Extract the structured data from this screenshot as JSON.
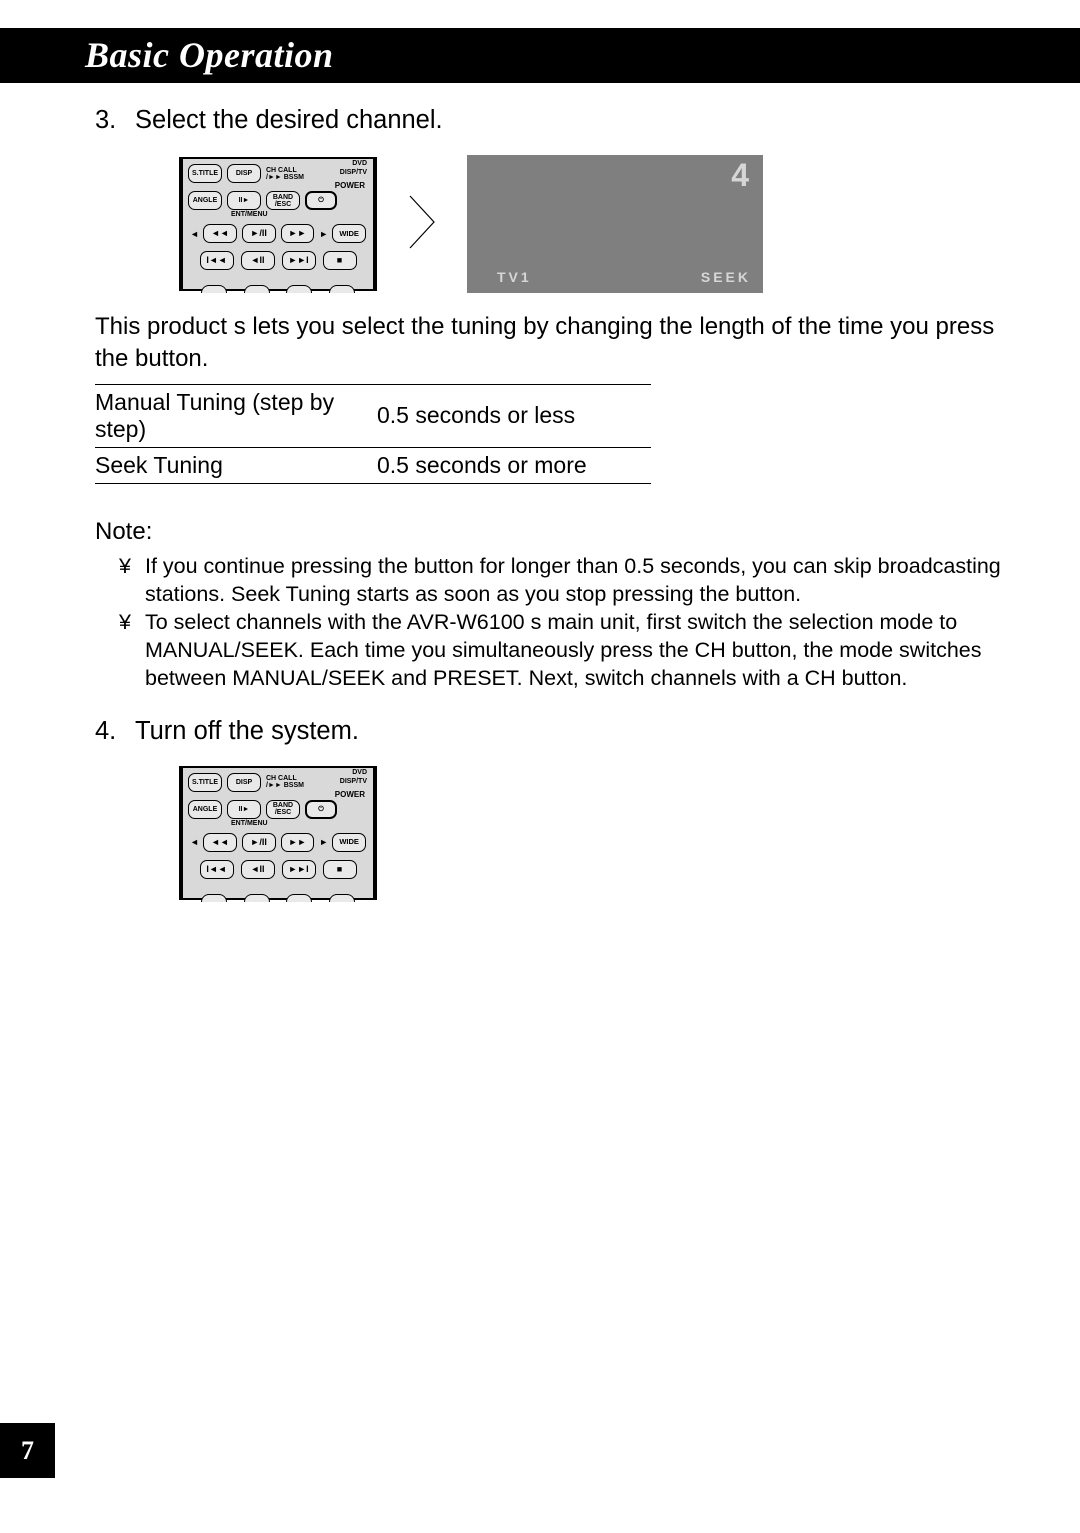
{
  "header": {
    "title": "Basic Operation"
  },
  "step3": {
    "num": "3.",
    "title": "Select the desired channel.",
    "description": "This product s lets you select the tuning by changing the length of the time you press the button.",
    "table": {
      "r1c1": "Manual Tuning (step by step)",
      "r1c2": "0.5 seconds or less",
      "r2c1": "Seek Tuning",
      "r2c2": "0.5 seconds or more"
    }
  },
  "note": {
    "title": "Note:",
    "bullet": "¥",
    "items": [
      "If you continue pressing the button for longer than 0.5 seconds, you can skip broadcasting stations. Seek Tuning starts as soon as you stop pressing the button.",
      "To select channels with the AVR-W6100 s main unit, first switch the selection mode to MANUAL/SEEK. Each time you simultaneously press the    CH button, the mode switches between MANUAL/SEEK and PRESET. Next, switch channels with a CH button."
    ]
  },
  "step4": {
    "num": "4.",
    "title": "Turn off the system."
  },
  "tv": {
    "channel": "4",
    "left": "TV1",
    "right": "SEEK"
  },
  "remote": {
    "stitle": "S.TITLE",
    "disp": "DISP",
    "chcall": "CH CALL",
    "bssm": "/►► BSSM",
    "angle": "ANGLE",
    "band": "BAND",
    "esc": "/ESC",
    "power_label": "POWER",
    "entmenu": "ENT/MENU",
    "wide": "WIDE",
    "dvd": "DVD",
    "disptv": "DISP/TV",
    "rev": "◄◄",
    "playpause": "►/II",
    "fwd": "►►",
    "prev": "I◄◄",
    "pause": "◄II",
    "next": "►►I",
    "stop": "■",
    "slowplay": "II►",
    "leftarrow": "◄",
    "rightarrow": "►",
    "uparrow": "▲"
  },
  "page_number": "7"
}
